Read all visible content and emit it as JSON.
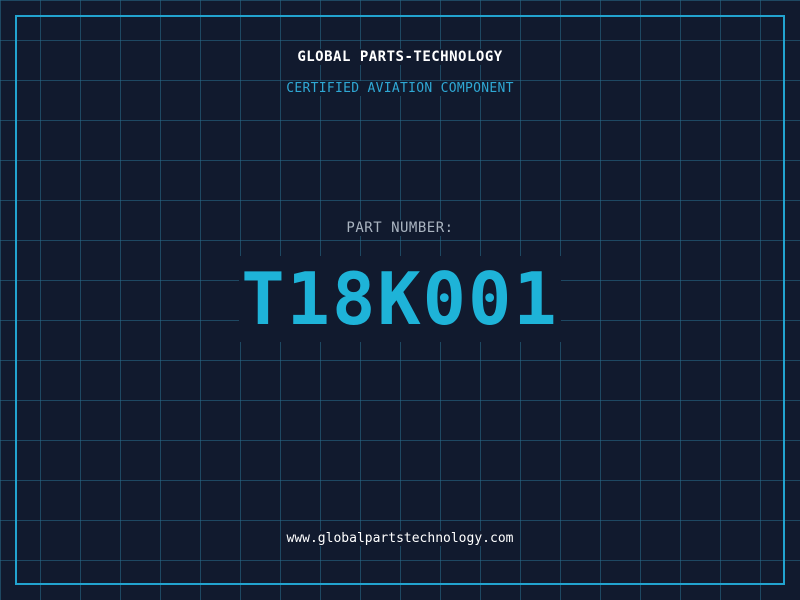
{
  "header": {
    "company_name": "GLOBAL PARTS-TECHNOLOGY",
    "subtitle": "CERTIFIED AVIATION COMPONENT"
  },
  "part": {
    "label": "PART NUMBER:",
    "number": "T18K001"
  },
  "footer": {
    "website": "www.globalpartstechnology.com"
  },
  "colors": {
    "background": "#111a2e",
    "grid_line": "#286e8c",
    "frame_border": "#22a3cf",
    "accent": "#1eb3d8",
    "heading_text": "#ffffff",
    "label_text": "#aab4c0"
  }
}
